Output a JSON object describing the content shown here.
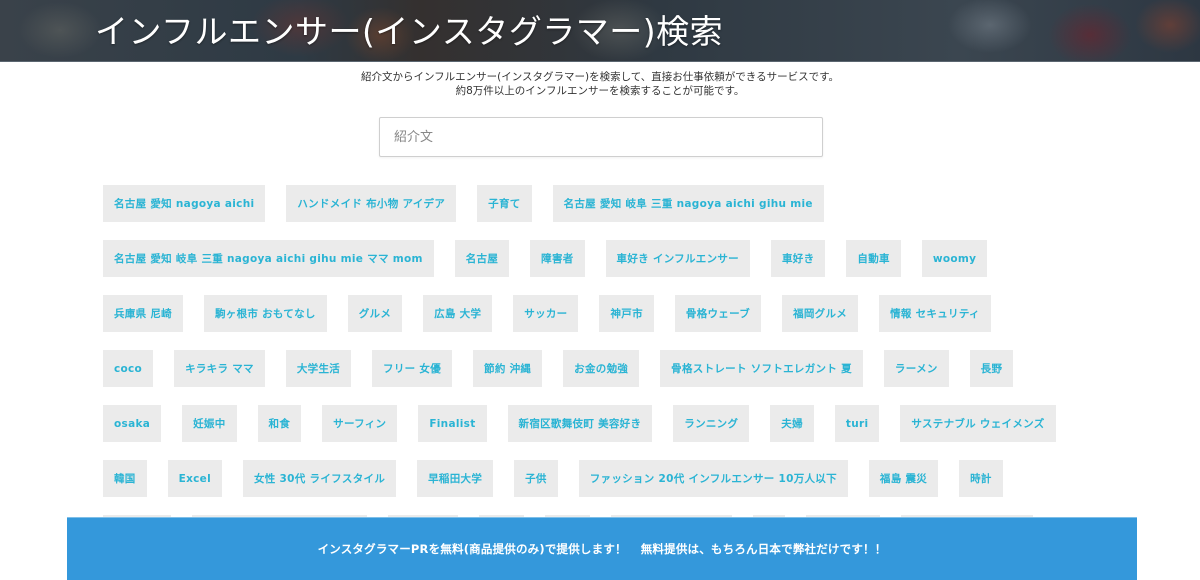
{
  "header": {
    "title": "インフルエンサー(インスタグラマー)検索"
  },
  "intro": {
    "line1": "紹介文からインフルエンサー(インスタグラマー)を検索して、直接お仕事依頼ができるサービスです。",
    "line2": "約8万件以上のインフルエンサーを検索することが可能です。"
  },
  "search": {
    "placeholder": "紹介文",
    "value": ""
  },
  "tag_rows": [
    [
      "名古屋 愛知 nagoya aichi",
      "ハンドメイド 布小物 アイデア",
      "子育て",
      "名古屋 愛知 岐阜 三重 nagoya aichi gihu mie"
    ],
    [
      "名古屋 愛知 岐阜 三重 nagoya aichi gihu mie ママ mom",
      "名古屋",
      "障害者",
      "車好き インフルエンサー",
      "車好き",
      "自動車",
      "woomy"
    ],
    [
      "兵庫県 尼崎",
      "駒ヶ根市 おもてなし",
      "グルメ",
      "広島 大学",
      "サッカー",
      "神戸市",
      "骨格ウェーブ",
      "福岡グルメ",
      "情報 セキュリティ"
    ],
    [
      "coco",
      "キラキラ ママ",
      "大学生活",
      "フリー 女優",
      "節約 沖縄",
      "お金の勉強",
      "骨格ストレート ソフトエレガント 夏",
      "ラーメン",
      "長野"
    ],
    [
      "osaka",
      "妊娠中",
      "和食",
      "サーフィン",
      "Finalist",
      "新宿区歌舞伎町 美容好き",
      "ランニング",
      "夫婦",
      "turi",
      "サステナブル ウェイメンズ"
    ],
    [
      "韓国",
      "Excel",
      "女性 30代 ライフスタイル",
      "早稲田大学",
      "子供",
      "ファッション 20代 インフルエンサー 10万人以下",
      "福島 震災",
      "時計"
    ]
  ],
  "banner": {
    "part1": "インスタグラマーPRを無料(商品提供のみ)で提供します！",
    "part2": "無料提供は、もちろん日本で弊社だけです！！"
  },
  "colors": {
    "tag_text": "#2ab4d4",
    "tag_bg": "#ebebeb",
    "banner_bg": "#3498db"
  }
}
